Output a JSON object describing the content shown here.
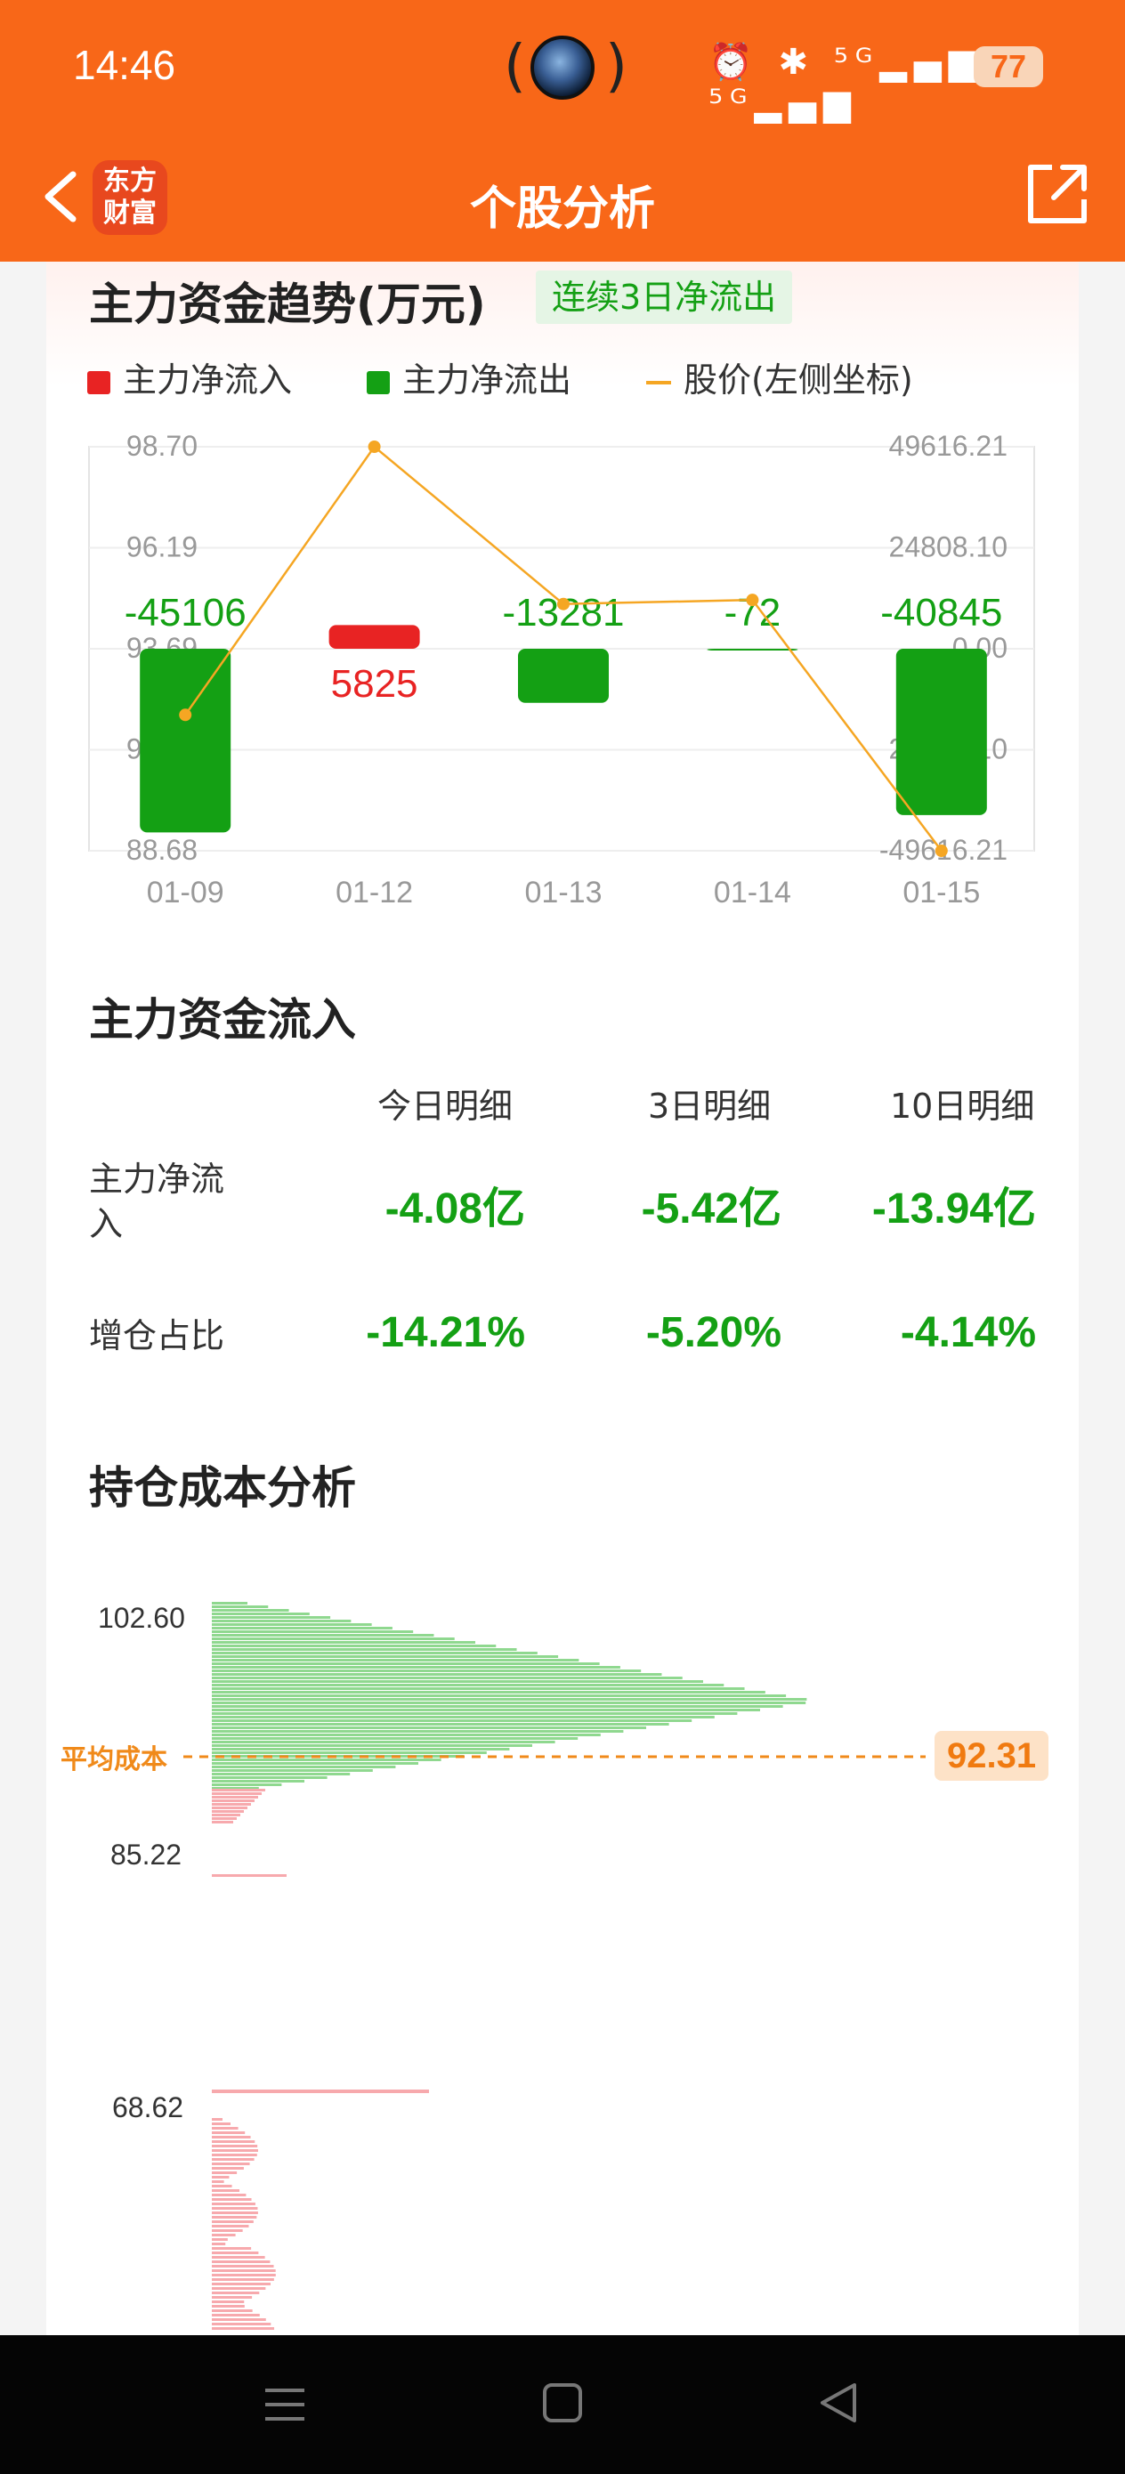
{
  "status_bar": {
    "time": "14:46",
    "center": "(",
    "center_r": ")",
    "icons": "⏰ ✱ ⁵ᴳ▂▄▆ ⁵ᴳ▂▄▆",
    "battery": "77"
  },
  "nav": {
    "back": "‹",
    "logo_line1": "东方",
    "logo_line2": "财富",
    "title": "个股分析"
  },
  "trend": {
    "title": "主力资金趋势(万元)",
    "tag": "连续3日净流出",
    "legend": {
      "inflow": "主力净流入",
      "outflow": "主力净流出",
      "price": "股价(左侧坐标)"
    },
    "colors": {
      "inflow": "#e82323",
      "outflow": "#14a014",
      "price": "#f5a623"
    }
  },
  "chart_data": {
    "type": "bar",
    "categories": [
      "01-09",
      "01-12",
      "01-13",
      "01-14",
      "01-15"
    ],
    "series": [
      {
        "name": "主力净流入",
        "values": [
          -45106,
          5825,
          -13281,
          -72,
          -40845
        ]
      },
      {
        "name": "股价(左侧坐标)",
        "values": [
          92.05,
          98.7,
          94.8,
          94.9,
          88.68
        ]
      }
    ],
    "left_axis_ticks": [
      "98.70",
      "96.19",
      "93.69",
      "91.19",
      "88.68"
    ],
    "right_axis_ticks": [
      "49616.21",
      "24808.10",
      "0.00",
      "24808.10",
      "-49616.21"
    ],
    "data_labels": [
      "-45106",
      "5825",
      "-13281",
      "-72",
      "-40845"
    ],
    "ylim_left": [
      88.68,
      98.7
    ],
    "ylim_right": [
      -49616.21,
      49616.21
    ]
  },
  "inflow": {
    "title": "主力资金流入",
    "headers": [
      "今日明细",
      "3日明细",
      "10日明细"
    ],
    "rows": [
      {
        "label": "主力净流入",
        "values": [
          "-4.08亿",
          "-5.42亿",
          "-13.94亿"
        ]
      },
      {
        "label": "增仓占比",
        "values": [
          "-14.21%",
          "-5.20%",
          "-4.14%"
        ]
      }
    ]
  },
  "cost": {
    "title": "持仓成本分析",
    "top_price": "102.60",
    "low_price": "85.22",
    "avg_label": "平均成本",
    "avg_value": "92.31",
    "lower_top": "68.62"
  }
}
